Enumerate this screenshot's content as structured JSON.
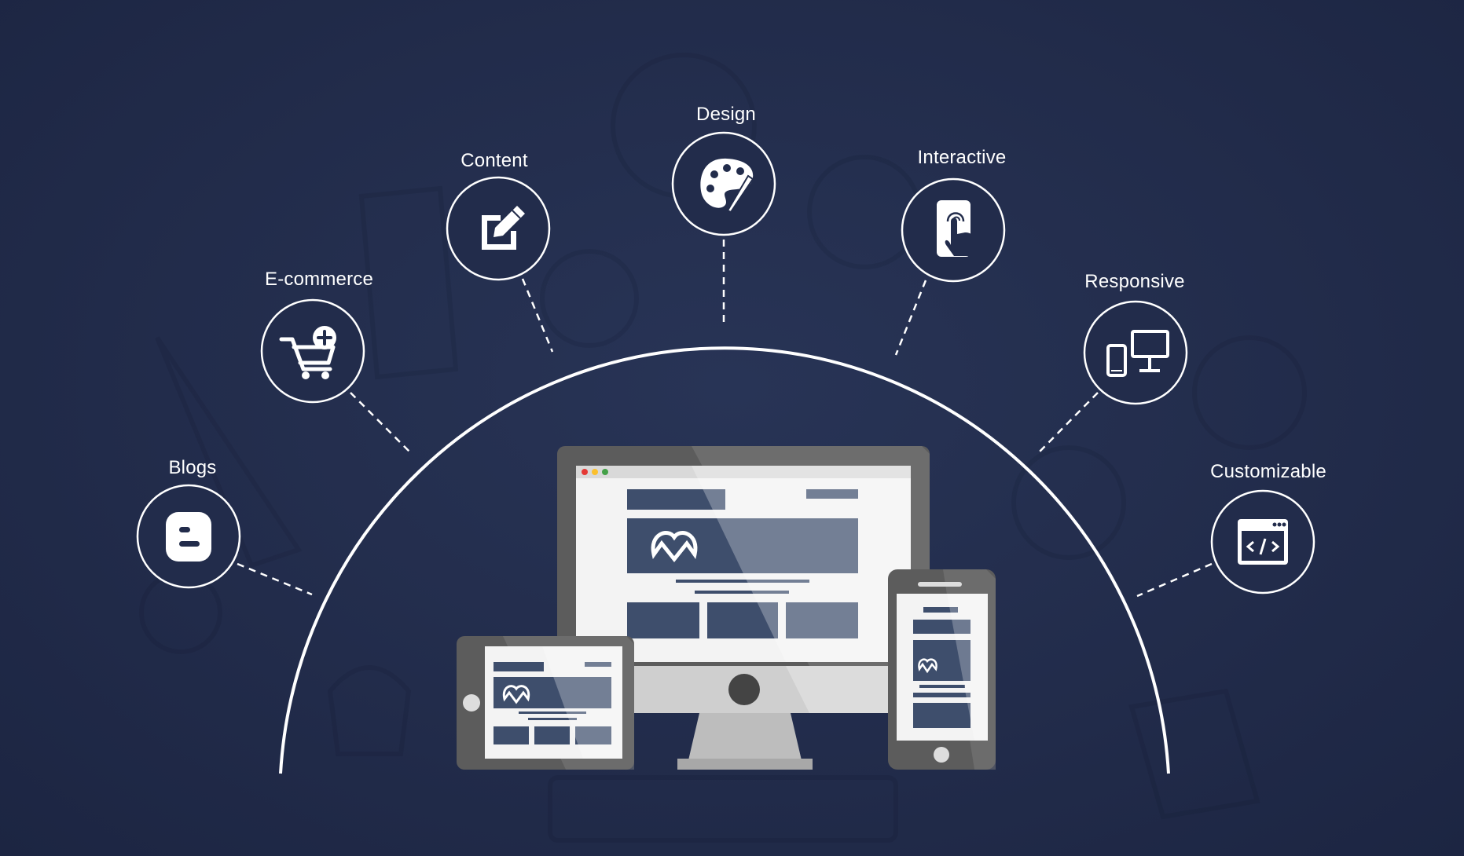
{
  "features": [
    {
      "id": "blogs",
      "label": "Blogs",
      "icon": "blogger-icon"
    },
    {
      "id": "ecommerce",
      "label": "E-commerce",
      "icon": "cart-add-icon"
    },
    {
      "id": "content",
      "label": "Content",
      "icon": "edit-icon"
    },
    {
      "id": "design",
      "label": "Design",
      "icon": "palette-icon"
    },
    {
      "id": "interactive",
      "label": "Interactive",
      "icon": "touch-icon"
    },
    {
      "id": "responsive",
      "label": "Responsive",
      "icon": "devices-icon"
    },
    {
      "id": "customizable",
      "label": "Customizable",
      "icon": "code-window-icon"
    }
  ],
  "colors": {
    "background": "#1f2a48",
    "line": "#ffffff",
    "device_frame": "#5c5c5c",
    "screen_block": "#3e4e6c",
    "screen_block_light": "#73849c"
  }
}
